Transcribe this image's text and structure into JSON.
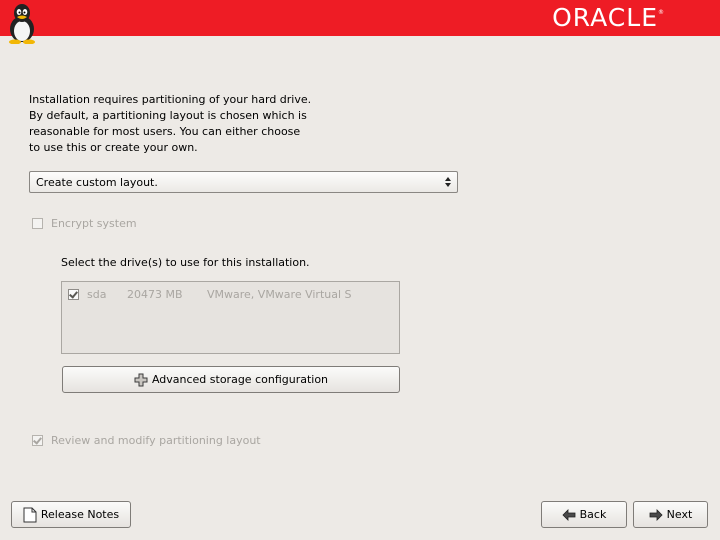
{
  "header": {
    "brand": "ORACLE",
    "brand_mark": "®",
    "logo_icon": "tux-penguin-icon",
    "color": "#ee1c25"
  },
  "intro_text": "Installation requires partitioning of your hard drive.\nBy default, a partitioning layout is chosen which is\nreasonable for most users.  You can either choose\nto use this or create your own.",
  "layout_select": {
    "value": "Create custom layout."
  },
  "encrypt": {
    "label": "Encrypt system",
    "checked": false,
    "enabled": false
  },
  "drives": {
    "label": "Select the drive(s) to use for this installation.",
    "items": [
      {
        "checked": true,
        "name": "sda",
        "size": "20473 MB",
        "model": "VMware, VMware Virtual S"
      }
    ]
  },
  "advanced_button": {
    "label": "Advanced storage configuration",
    "icon": "plus-icon"
  },
  "review": {
    "label": "Review and modify partitioning layout",
    "checked": true,
    "enabled": false
  },
  "footer": {
    "release_notes": "Release Notes",
    "back": "Back",
    "next": "Next"
  }
}
